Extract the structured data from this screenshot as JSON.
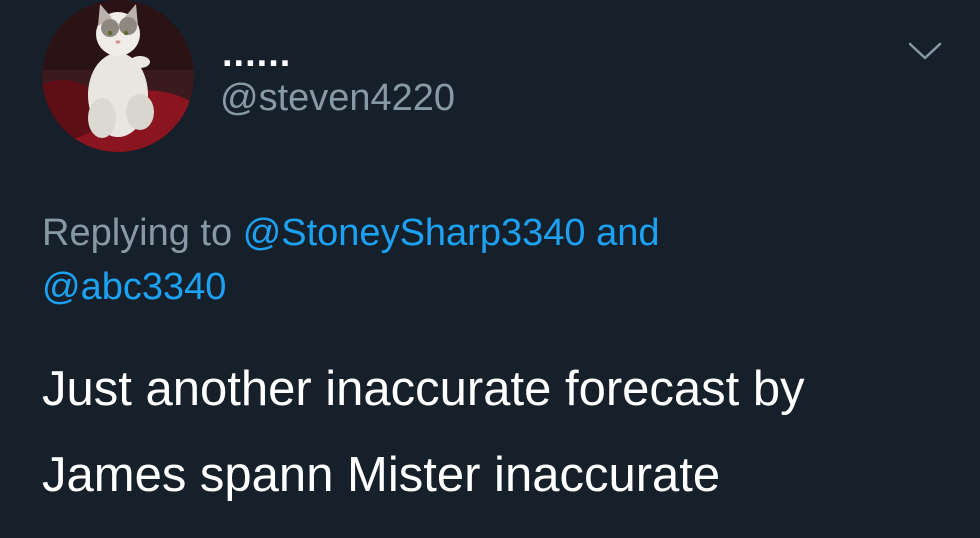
{
  "user": {
    "display_name": "......",
    "handle": "@steven4220"
  },
  "reply": {
    "prefix": "Replying to",
    "mention_1": "@StoneySharp3340",
    "conjunction": "and",
    "mention_2": "@abc3340"
  },
  "tweet": {
    "text": "Just another inaccurate forecast by James spann Mister inaccurate"
  },
  "colors": {
    "background": "#15202b",
    "text_primary": "#ffffff",
    "text_secondary": "#8899a6",
    "link": "#1da1f2"
  },
  "icons": {
    "menu": "chevron-down-icon",
    "avatar": "cat-photo"
  }
}
